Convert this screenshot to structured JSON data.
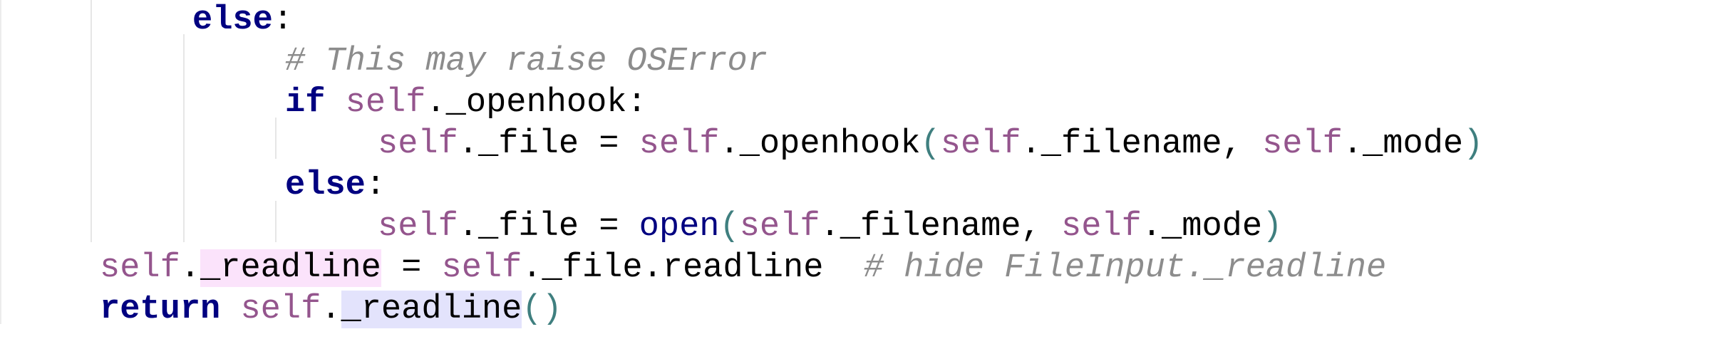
{
  "editor": {
    "lines": {
      "l1": {
        "kw": "else",
        "colon": ":"
      },
      "l2": {
        "comment": "# This may raise OSError"
      },
      "l3": {
        "kw": "if",
        "self": "self",
        "attr": "._openhook",
        "colon": ":"
      },
      "l4": {
        "self1": "self",
        "attr1": "._file = ",
        "self2": "self",
        "attr2": "._openhook",
        "open_paren": "(",
        "self3": "self",
        "attr3": "._filename, ",
        "self4": "self",
        "attr4": "._mode",
        "close_paren": ")"
      },
      "l5": {
        "kw": "else",
        "colon": ":"
      },
      "l6": {
        "self1": "self",
        "attr1": "._file = ",
        "builtin": "open",
        "open_paren": "(",
        "self2": "self",
        "attr2": "._filename, ",
        "self3": "self",
        "attr3": "._mode",
        "close_paren": ")"
      },
      "l7": {
        "self1": "self",
        "dot": ".",
        "attr_hl": "_readline",
        "eq": " = ",
        "self2": "self",
        "attr2": "._file.readline",
        "spaces": "  ",
        "comment": "# hide FileInput._readline"
      },
      "l8": {
        "kw": "return",
        "space": " ",
        "self": "self",
        "dot": ".",
        "attr_hl": "_readline",
        "parens": "()"
      }
    }
  }
}
